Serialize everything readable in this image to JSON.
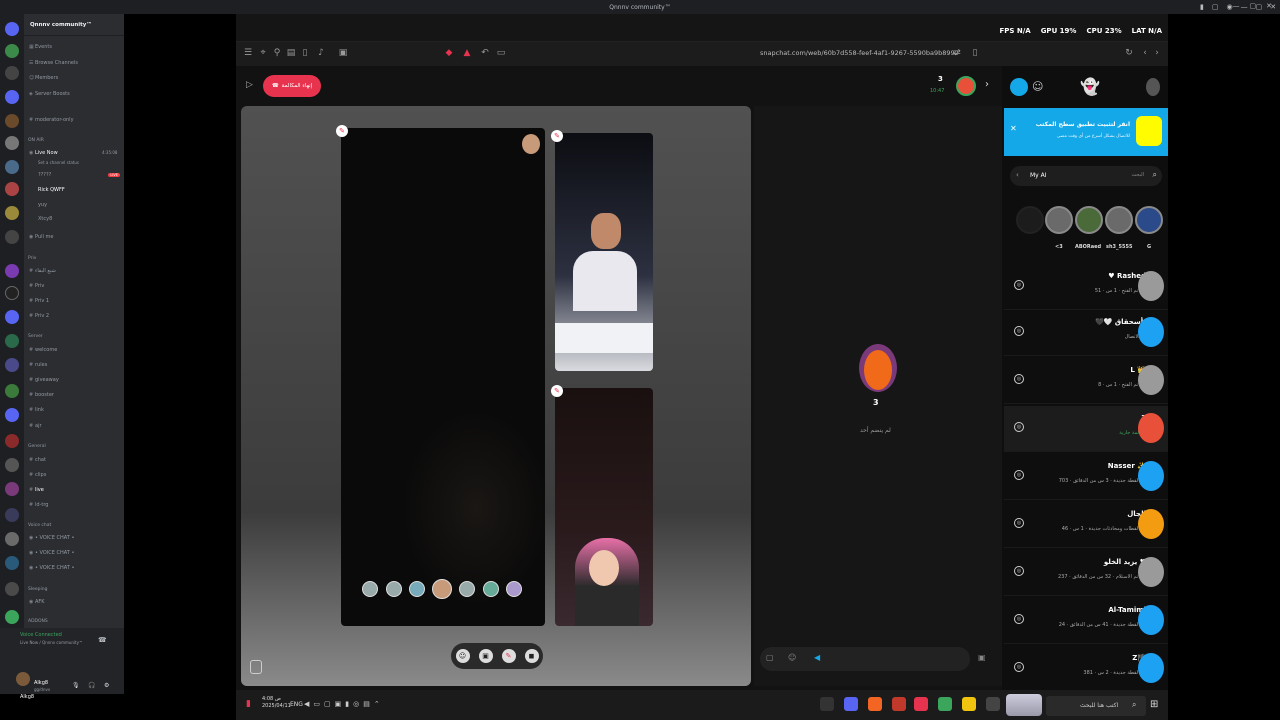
{
  "window": {
    "title": "Qnnnv community™"
  },
  "overlay": {
    "fps": "FPS N/A",
    "gpu": "GPU 19%",
    "cpu": "CPU 23%",
    "lat": "LAT N/A"
  },
  "discord": {
    "server_name": "Qnnnv community™",
    "top_items": [
      "Events",
      "Browse Channels",
      "Members",
      "Server Boosts"
    ],
    "moderator": "moderator-only",
    "on_air_label": "ON AIR",
    "live_now": {
      "name": "Live Now",
      "status": "Set a channel status",
      "time": "4:35:08"
    },
    "voice_users": [
      "?????",
      "Rick QWFF",
      "yuy",
      "Xtcy8"
    ],
    "live_badge": "LIVE",
    "pull_me": "Pull me",
    "priv_label": "Priv",
    "priv_items": [
      "شبع البقاء",
      "Priv",
      "Priv 1",
      "Priv 2"
    ],
    "server_label": "Server",
    "server_items": [
      "welcome",
      "rules",
      "giveaway",
      "booster",
      "link",
      "ajr"
    ],
    "general_label": "General",
    "general_items": [
      "chat",
      "clips",
      "live",
      "ld-trg"
    ],
    "voice_label": "Voice chat",
    "voice_items": [
      "• VOICE CHAT •",
      "• VOICE CHAT •",
      "• VOICE CHAT •"
    ],
    "sleeping_label": "Sleeping",
    "sleeping_items": [
      "AFK"
    ],
    "addons_label": "ADDONS",
    "voice_connected": "Voice Connected",
    "voice_sub": "Live Now / Qnnnv community™",
    "username": "Alkg8",
    "user_tag": "gg/dnvv"
  },
  "browser": {
    "url": "snapchat.com/web/60b7d558-feef-4af1-9267-5590ba9b8992"
  },
  "call": {
    "end_call_label": "إنهاء المكالمة",
    "participant_count": "3",
    "participant_time": "10:47",
    "group_name": "3",
    "group_sub": "لم ينضم أحد"
  },
  "snap_sidebar": {
    "banner_title": "انقر لتثبيت تطبيق سطح المكتب",
    "banner_sub": "للاتصال بشكل أسرع من أي وقت مضى",
    "search_placeholder": "البحث",
    "my_ai": "My AI",
    "stories": [
      {
        "label": "<3"
      },
      {
        "label": "ABORaed"
      },
      {
        "label": "sh3_5555"
      },
      {
        "label": "G"
      }
    ],
    "friends": [
      {
        "name": "♥ Rashed",
        "status": "تم الفتح · 1 س · 51 🔥",
        "color": "#9a9a9a"
      },
      {
        "name": "🖤🤍 بأسحقاق",
        "status": "تم الاتصال",
        "color": "#1da1f2"
      },
      {
        "name": "L 👑",
        "status": "تم الفتح · 1 س · 8 🔥",
        "color": "#9a9a9a"
      },
      {
        "name": "3",
        "status": "مكالمة جارية",
        "color": "#e8503a",
        "selected": true
      },
      {
        "name": "Nasser ✨",
        "status": "لقطة جديدة · 3 س من الدقائق · 703 🔥",
        "color": "#1da1f2"
      },
      {
        "name": "الجال",
        "status": "لقطات ومحادثات جديدة · 1 س · 46 🔥",
        "color": "#f39c12"
      },
      {
        "name": "يزيد الخلو ♥",
        "status": "تم الاستلام · 32 س من الدقائق · 237 🔥",
        "color": "#9a9a9a"
      },
      {
        "name": "Al-Tamimi",
        "status": "لقطة جديدة · 41 س من الدقائق · 24 🔥",
        "color": "#1da1f2"
      },
      {
        "name": "Z🏴",
        "status": "لقطة جديدة · 2 س · 381 🔥",
        "color": "#1da1f2"
      }
    ]
  },
  "taskbar": {
    "lang": "ENG",
    "time": "4:08 ص",
    "date": "2025/04/11",
    "search_placeholder": "اكتب هنا للبحث"
  }
}
